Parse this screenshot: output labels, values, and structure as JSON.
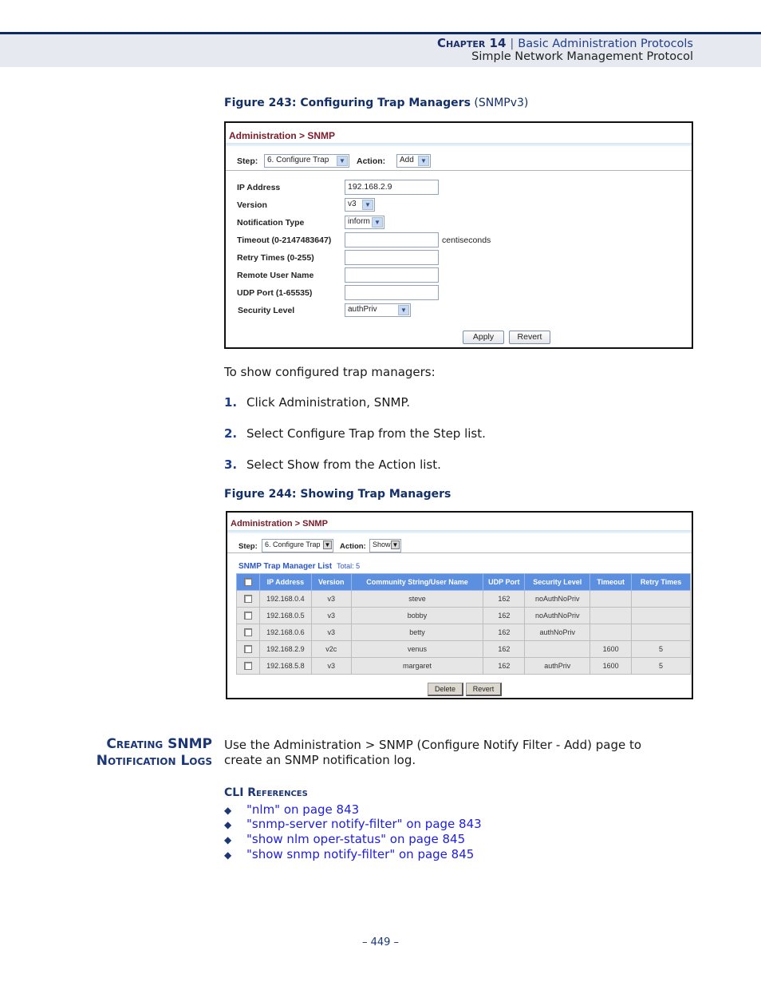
{
  "header": {
    "chapter_label": "Chapter 14",
    "separator": "|",
    "chapter_title": "Basic Administration Protocols",
    "section_title": "Simple Network Management Protocol"
  },
  "figure243": {
    "caption_bold": "Figure 243:  Configuring Trap Managers",
    "caption_normal": " (SNMPv3)",
    "breadcrumb": "Administration > SNMP",
    "step_label": "Step:",
    "step_value": "6. Configure Trap",
    "action_label": "Action:",
    "action_value": "Add",
    "fields": [
      {
        "label": "IP Address",
        "value": "192.168.2.9",
        "type": "text"
      },
      {
        "label": "Version",
        "value": "v3",
        "type": "select"
      },
      {
        "label": "Notification Type",
        "value": "inform",
        "type": "select"
      },
      {
        "label": "Timeout (0-2147483647)",
        "value": "",
        "type": "text",
        "unit": "centiseconds"
      },
      {
        "label": "Retry Times (0-255)",
        "value": "",
        "type": "text"
      },
      {
        "label": "Remote User Name",
        "value": "",
        "type": "text"
      },
      {
        "label": "UDP Port (1-65535)",
        "value": "",
        "type": "text"
      },
      {
        "label": "Security Level",
        "value": "authPriv",
        "type": "select"
      }
    ],
    "apply_label": "Apply",
    "revert_label": "Revert"
  },
  "intro_text": "To show configured trap managers:",
  "steps": [
    {
      "num": "1.",
      "text": "Click Administration, SNMP."
    },
    {
      "num": "2.",
      "text": "Select Configure Trap from the Step list."
    },
    {
      "num": "3.",
      "text": "Select Show from the Action list."
    }
  ],
  "figure244": {
    "caption": "Figure 244:  Showing Trap Managers",
    "breadcrumb": "Administration > SNMP",
    "step_label": "Step:",
    "step_value": "6. Configure Trap",
    "action_label": "Action:",
    "action_value": "Show",
    "list_title": "SNMP Trap Manager List",
    "list_total": "Total: 5",
    "columns": [
      "",
      "IP Address",
      "Version",
      "Community String/User Name",
      "UDP Port",
      "Security Level",
      "Timeout",
      "Retry Times"
    ],
    "rows": [
      {
        "ip": "192.168.0.4",
        "version": "v3",
        "name": "steve",
        "udp": "162",
        "security": "noAuthNoPriv",
        "timeout": "",
        "retry": ""
      },
      {
        "ip": "192.168.0.5",
        "version": "v3",
        "name": "bobby",
        "udp": "162",
        "security": "noAuthNoPriv",
        "timeout": "",
        "retry": ""
      },
      {
        "ip": "192.168.0.6",
        "version": "v3",
        "name": "betty",
        "udp": "162",
        "security": "authNoPriv",
        "timeout": "",
        "retry": ""
      },
      {
        "ip": "192.168.2.9",
        "version": "v2c",
        "name": "venus",
        "udp": "162",
        "security": "",
        "timeout": "1600",
        "retry": "5"
      },
      {
        "ip": "192.168.5.8",
        "version": "v3",
        "name": "margaret",
        "udp": "162",
        "security": "authPriv",
        "timeout": "1600",
        "retry": "5"
      }
    ],
    "delete_label": "Delete",
    "revert_label": "Revert"
  },
  "section": {
    "heading_line1": "Creating SNMP",
    "heading_line2": "Notification Logs",
    "body_line1": "Use the Administration > SNMP (Configure Notify Filter - Add) page to",
    "body_line2": "create an SNMP notification log.",
    "cli_heading": "CLI References",
    "bullet_glyph": "◆",
    "cli_refs": [
      "\"nlm\" on page 843",
      "\"snmp-server notify-filter\" on page 843",
      "\"show nlm oper-status\" on page 845",
      "\"show snmp notify-filter\" on page 845"
    ]
  },
  "footer": {
    "page_number": "–  449  –"
  }
}
